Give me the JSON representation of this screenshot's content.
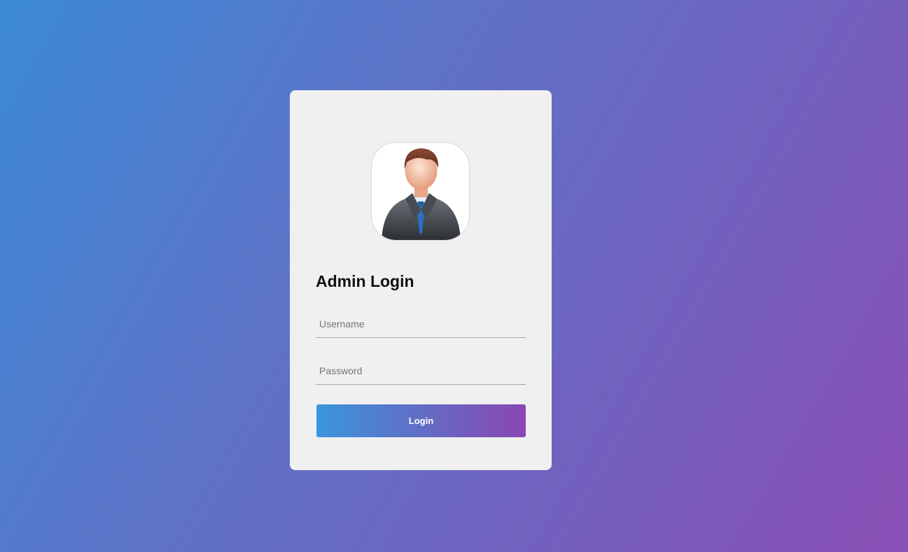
{
  "login": {
    "title": "Admin Login",
    "avatar_icon": "user-avatar-icon",
    "username": {
      "placeholder": "Username",
      "value": ""
    },
    "password": {
      "placeholder": "Password",
      "value": ""
    },
    "submit_label": "Login"
  },
  "colors": {
    "background_start": "#3b8ad6",
    "background_end": "#8a4fb5",
    "card": "#f0f0f0",
    "button_start": "#3a96dc",
    "button_end": "#8a47b3"
  }
}
